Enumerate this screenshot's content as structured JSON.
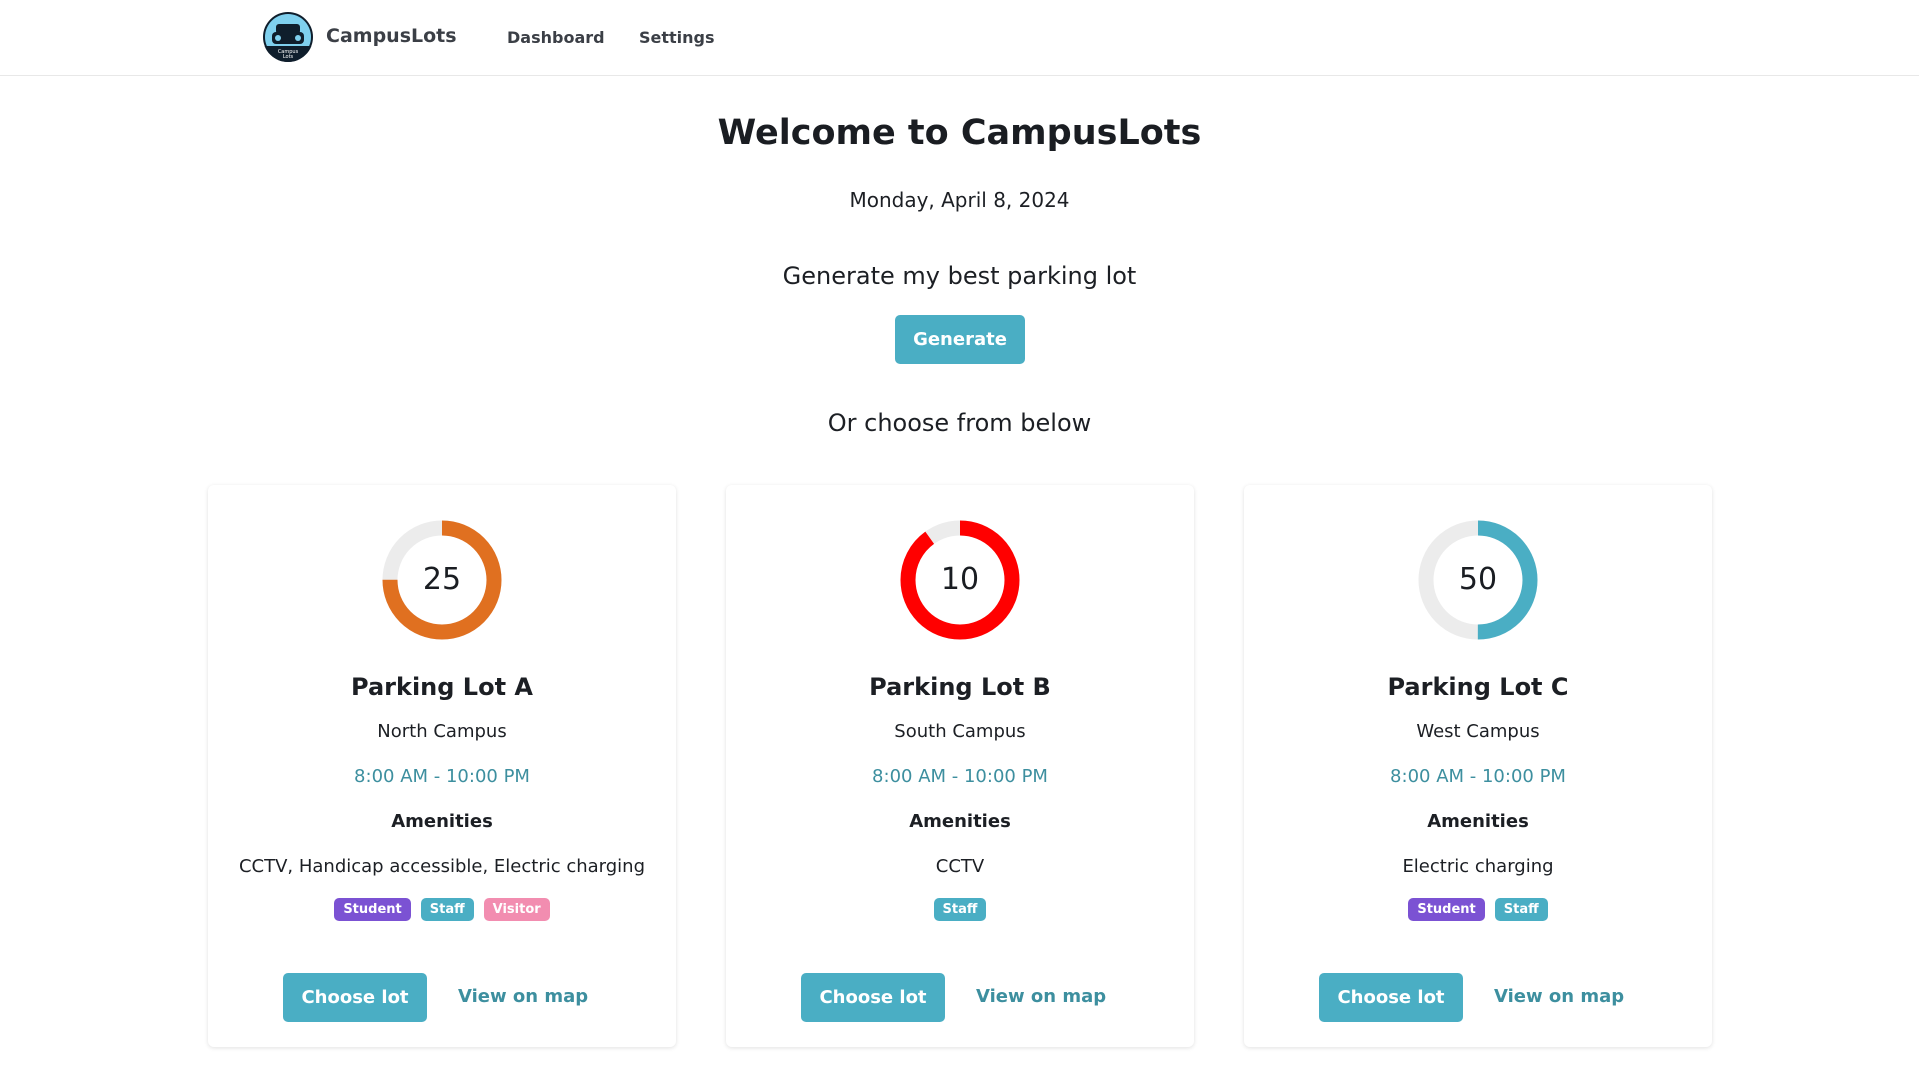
{
  "nav": {
    "brand": "CampusLots",
    "logo_text": "Campus Lots",
    "links": [
      "Dashboard",
      "Settings"
    ]
  },
  "main": {
    "title": "Welcome to CampusLots",
    "date": "Monday, April 8, 2024",
    "generate_prompt": "Generate my best parking lot",
    "generate_label": "Generate",
    "choose_prompt": "Or choose from below"
  },
  "lots": [
    {
      "value": "25",
      "fill_percent": 75,
      "color": "#e07020",
      "name": "Parking Lot A",
      "campus": "North Campus",
      "hours": "8:00 AM - 10:00 PM",
      "amenities_label": "Amenities",
      "amenities": "CCTV, Handicap accessible, Electric charging",
      "badges": [
        "Student",
        "Staff",
        "Visitor"
      ],
      "choose_label": "Choose lot",
      "map_label": "View on map"
    },
    {
      "value": "10",
      "fill_percent": 90,
      "color": "#ff0000",
      "name": "Parking Lot B",
      "campus": "South Campus",
      "hours": "8:00 AM - 10:00 PM",
      "amenities_label": "Amenities",
      "amenities": "CCTV",
      "badges": [
        "Staff"
      ],
      "choose_label": "Choose lot",
      "map_label": "View on map"
    },
    {
      "value": "50",
      "fill_percent": 50,
      "color": "#4aaec4",
      "name": "Parking Lot C",
      "campus": "West Campus",
      "hours": "8:00 AM - 10:00 PM",
      "amenities_label": "Amenities",
      "amenities": "Electric charging",
      "badges": [
        "Student",
        "Staff"
      ],
      "choose_label": "Choose lot",
      "map_label": "View on map"
    }
  ],
  "badge_colors": {
    "Student": "#7b52d3",
    "Staff": "#4aaec4",
    "Visitor": "#f28db0"
  }
}
